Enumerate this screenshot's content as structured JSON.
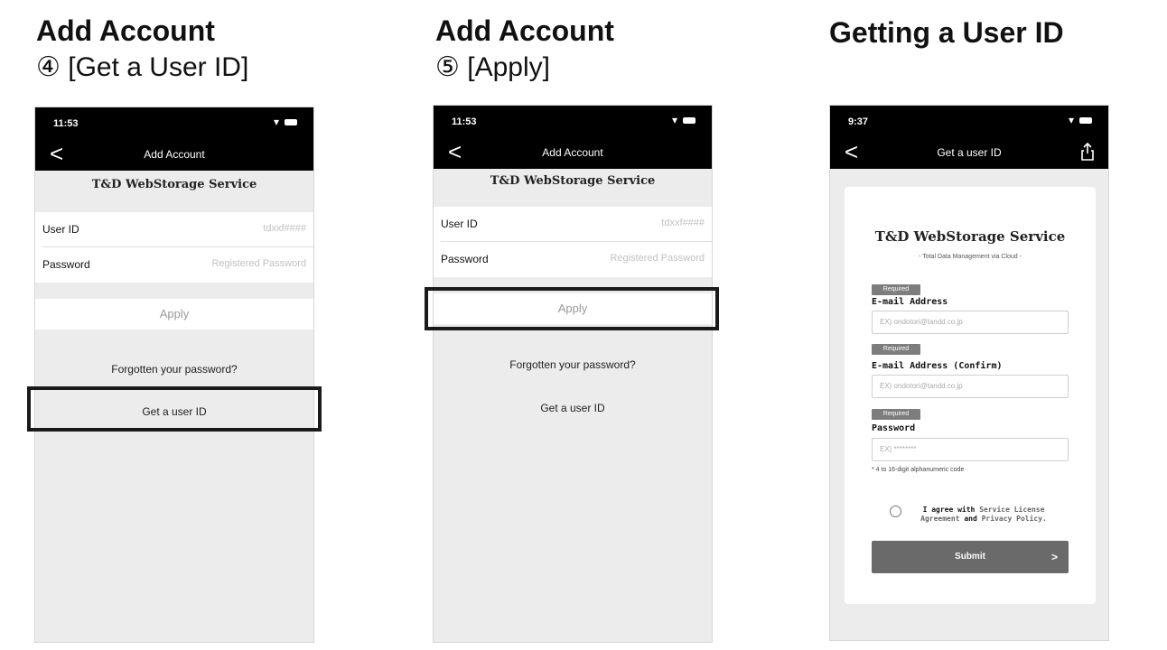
{
  "col1": {
    "heading": "Add Account",
    "step": "④ [Get a User ID]",
    "phone": {
      "time": "11:53",
      "back": "<",
      "title": "Add Account",
      "service": "T&D WebStorage Service",
      "userid_label": "User ID",
      "userid_placeholder": "tdxxf####",
      "password_label": "Password",
      "password_placeholder": "Registered Password",
      "apply": "Apply",
      "forgot": "Forgotten your password?",
      "get_user_id": "Get a user ID"
    }
  },
  "col2": {
    "heading": "Add Account",
    "step": "⑤ [Apply]",
    "phone": {
      "time": "11:53",
      "back": "<",
      "title": "Add Account",
      "service": "T&D WebStorage Service",
      "userid_label": "User ID",
      "userid_placeholder": "tdxxf####",
      "password_label": "Password",
      "password_placeholder": "Registered Password",
      "apply": "Apply",
      "forgot": "Forgotten your password?",
      "get_user_id": "Get a user ID"
    }
  },
  "col3": {
    "heading": "Getting a User ID",
    "phone": {
      "time": "9:37",
      "back": "<",
      "title": "Get a user ID",
      "service": "T&D WebStorage Service",
      "service_sub": "- Total Data Management via Cloud -",
      "required": "Required",
      "email_label": "E-mail Address",
      "email_placeholder": "EX) ondotori@tandd.co.jp",
      "email_confirm_label": "E-mail Address (Confirm)",
      "email_confirm_placeholder": "EX) ondotori@tandd.co.jp",
      "password_label": "Password",
      "password_placeholder": "EX) ********",
      "password_hint": "* 4 to 16-digit alphanumeric code",
      "agree_prefix": "I agree with",
      "agree_service": "Service License Agreement",
      "agree_and": "and",
      "agree_privacy": "Privacy Policy.",
      "submit": "Submit",
      "submit_arrow": ">"
    }
  }
}
